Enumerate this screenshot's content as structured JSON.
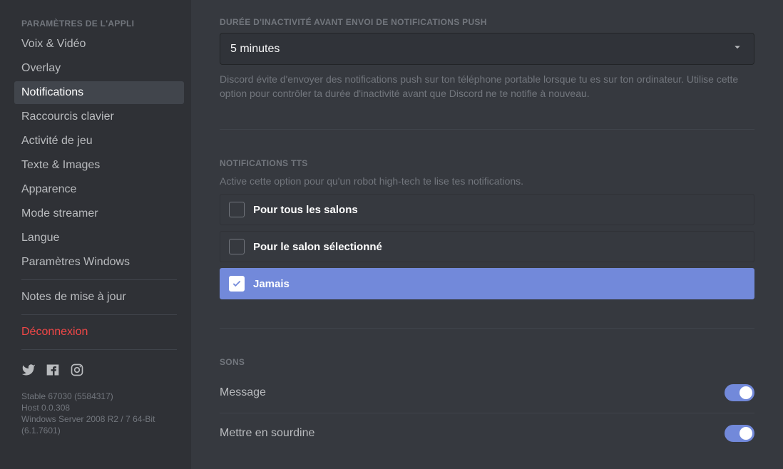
{
  "sidebar": {
    "header": "PARAMÈTRES DE L'APPLI",
    "items": [
      {
        "label": "Voix & Vidéo"
      },
      {
        "label": "Overlay"
      },
      {
        "label": "Notifications",
        "selected": true
      },
      {
        "label": "Raccourcis clavier"
      },
      {
        "label": "Activité de jeu"
      },
      {
        "label": "Texte & Images"
      },
      {
        "label": "Apparence"
      },
      {
        "label": "Mode streamer"
      },
      {
        "label": "Langue"
      },
      {
        "label": "Paramètres Windows"
      }
    ],
    "changelog": "Notes de mise à jour",
    "logout": "Déconnexion",
    "version": {
      "line1": "Stable 67030 (5584317)",
      "line2": "Host 0.0.308",
      "line3": "Windows Server 2008 R2 / 7 64-Bit (6.1.7601)"
    }
  },
  "push": {
    "title": "DURÉE D'INACTIVITÉ AVANT ENVOI DE NOTIFICATIONS PUSH",
    "value": "5 minutes",
    "help": "Discord évite d'envoyer des notifications push sur ton téléphone portable lorsque tu es sur ton ordinateur. Utilise cette option pour contrôler ta durée d'inactivité avant que Discord ne te notifie à nouveau."
  },
  "tts": {
    "title": "NOTIFICATIONS TTS",
    "help": "Active cette option pour qu'un robot high-tech te lise tes notifications.",
    "options": [
      {
        "label": "Pour tous les salons"
      },
      {
        "label": "Pour le salon sélectionné"
      },
      {
        "label": "Jamais",
        "selected": true
      }
    ]
  },
  "sounds": {
    "title": "SONS",
    "items": [
      {
        "label": "Message",
        "on": true
      },
      {
        "label": "Mettre en sourdine",
        "on": true
      }
    ]
  }
}
